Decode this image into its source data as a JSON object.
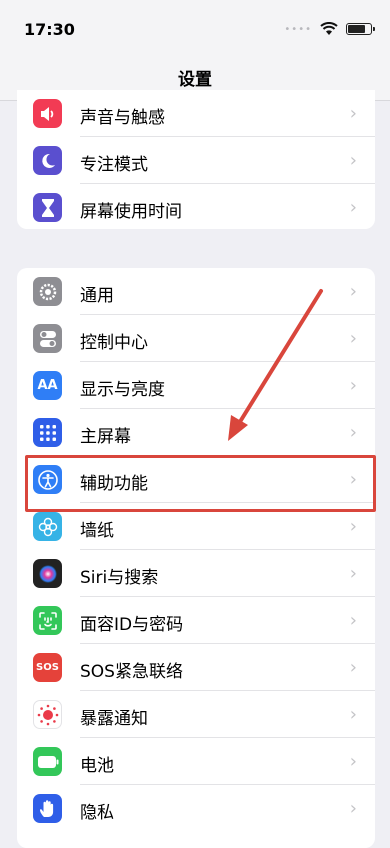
{
  "status": {
    "time": "17:30"
  },
  "nav": {
    "title": "设置"
  },
  "group1": [
    {
      "label": "声音与触感",
      "icon": "speaker-icon",
      "color": "#f23b54"
    },
    {
      "label": "专注模式",
      "icon": "moon-icon",
      "color": "#5a4fcf"
    },
    {
      "label": "屏幕使用时间",
      "icon": "hourglass-icon",
      "color": "#5a4fcf"
    }
  ],
  "group2": [
    {
      "label": "通用",
      "icon": "gear-icon",
      "color": "#8e8e93"
    },
    {
      "label": "控制中心",
      "icon": "toggles-icon",
      "color": "#8e8e93"
    },
    {
      "label": "显示与亮度",
      "icon": "text-size-icon",
      "color": "#2f7ef6"
    },
    {
      "label": "主屏幕",
      "icon": "grid-icon",
      "color": "#2f5ee8"
    },
    {
      "label": "辅助功能",
      "icon": "accessibility-icon",
      "color": "#2f7ef6"
    },
    {
      "label": "墙纸",
      "icon": "flower-icon",
      "color": "#36b3e6"
    },
    {
      "label": "Siri与搜索",
      "icon": "siri-icon",
      "color": "#222222"
    },
    {
      "label": "面容ID与密码",
      "icon": "faceid-icon",
      "color": "#33c759"
    },
    {
      "label": "SOS紧急联络",
      "icon": "sos-icon",
      "color": "#e5423a"
    },
    {
      "label": "暴露通知",
      "icon": "exposure-icon",
      "color": "#ffffff"
    },
    {
      "label": "电池",
      "icon": "battery-icon",
      "color": "#33c759"
    },
    {
      "label": "隐私",
      "icon": "hand-icon",
      "color": "#2f5ee8"
    }
  ],
  "icon_text": {
    "text_size": "AA",
    "sos": "SOS"
  }
}
